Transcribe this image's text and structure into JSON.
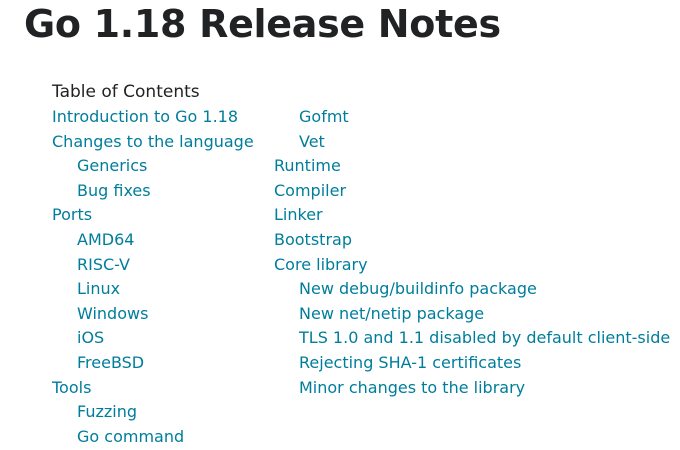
{
  "page": {
    "title": "Go 1.18 Release Notes"
  },
  "toc": {
    "heading": "Table of Contents",
    "left": [
      {
        "label": "Introduction to Go 1.18",
        "level": 1
      },
      {
        "label": "Changes to the language",
        "level": 1
      },
      {
        "label": "Generics",
        "level": 2
      },
      {
        "label": "Bug fixes",
        "level": 2
      },
      {
        "label": "Ports",
        "level": 1
      },
      {
        "label": "AMD64",
        "level": 2
      },
      {
        "label": "RISC-V",
        "level": 2
      },
      {
        "label": "Linux",
        "level": 2
      },
      {
        "label": "Windows",
        "level": 2
      },
      {
        "label": "iOS",
        "level": 2
      },
      {
        "label": "FreeBSD",
        "level": 2
      },
      {
        "label": "Tools",
        "level": 1
      },
      {
        "label": "Fuzzing",
        "level": 2
      },
      {
        "label": "Go command",
        "level": 2
      }
    ],
    "right": [
      {
        "label": "Gofmt",
        "level": 2
      },
      {
        "label": "Vet",
        "level": 2
      },
      {
        "label": "Runtime",
        "level": 1
      },
      {
        "label": "Compiler",
        "level": 1
      },
      {
        "label": "Linker",
        "level": 1
      },
      {
        "label": "Bootstrap",
        "level": 1
      },
      {
        "label": "Core library",
        "level": 1
      },
      {
        "label": "New debug/buildinfo package",
        "level": 2
      },
      {
        "label": "New net/netip package",
        "level": 2
      },
      {
        "label": "TLS 1.0 and 1.1 disabled by default client-side",
        "level": 2
      },
      {
        "label": "Rejecting SHA-1 certificates",
        "level": 2
      },
      {
        "label": "Minor changes to the library",
        "level": 2
      }
    ]
  },
  "colors": {
    "link": "#007d9c",
    "text": "#202224"
  }
}
